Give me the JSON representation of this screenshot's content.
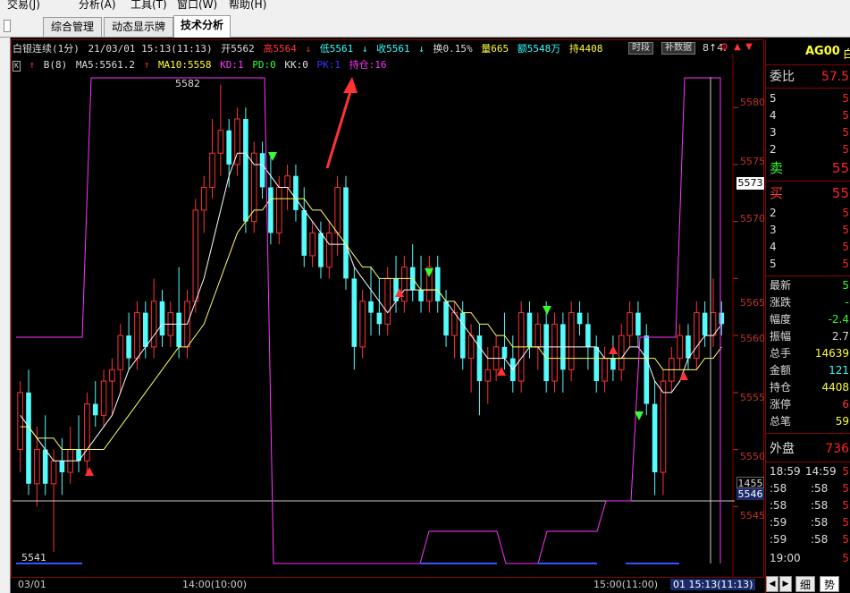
{
  "menu": {
    "items": [
      "交易(J)",
      "分析(A)",
      "工具(T)",
      "窗口(W)",
      "帮助(H)"
    ]
  },
  "tabs": [
    {
      "label": "综合管理",
      "active": false
    },
    {
      "label": "动态显示牌",
      "active": false
    },
    {
      "label": "技术分析",
      "active": true
    }
  ],
  "info_line1": {
    "title": "白银连续(1分)",
    "datetime": "21/03/01 15:13(11:13)",
    "open": "开5562",
    "high": "高5564",
    "low": "低5561",
    "close": "收5561",
    "turnover_rate": "换0.15%",
    "volume": "量665",
    "amount": "额5548万",
    "position": "持4408",
    "btn_timemode": "时段",
    "btn_supplement": "补数据",
    "tail": "8↑4."
  },
  "info_line2": {
    "k_button": "K",
    "indicator": "B(8)",
    "ma5": "MA5:5561.2",
    "ma10": "MA10:5558",
    "kd": "KD:1",
    "pd": "PD:0",
    "kk": "KK:0",
    "pk": "PK:1",
    "chicang": "持仓:16"
  },
  "right_panel": {
    "code": "AG00",
    "name": "白",
    "weibi_label": "委比",
    "weibi_value": "57.5",
    "asks": [
      {
        "level": "5",
        "price": "5"
      },
      {
        "level": "4",
        "price": "5"
      },
      {
        "level": "3",
        "price": "5"
      },
      {
        "level": "2",
        "price": "5"
      }
    ],
    "sell_label": "卖",
    "sell_value": "55",
    "buy_label": "买",
    "buy_value": "55",
    "bids": [
      {
        "level": "2",
        "price": "5"
      },
      {
        "level": "3",
        "price": "5"
      },
      {
        "level": "4",
        "price": "5"
      },
      {
        "level": "5",
        "price": "5"
      }
    ],
    "stats": [
      {
        "label": "最新",
        "value": "5"
      },
      {
        "label": "涨跌",
        "value": "-"
      },
      {
        "label": "幅度",
        "value": "-2.4"
      },
      {
        "label": "振幅",
        "value": "2.7"
      },
      {
        "label": "总手",
        "value": "14639"
      },
      {
        "label": "金额",
        "value": "121"
      },
      {
        "label": "持仓",
        "value": "4408"
      },
      {
        "label": "涨停",
        "value": "6"
      },
      {
        "label": "总笔",
        "value": "59"
      }
    ],
    "waipan_label": "外盘",
    "waipan_value": "736",
    "ticks": [
      {
        "time": "18:59",
        "time2": "14:59",
        "v": "5"
      },
      {
        "time": ":58",
        "time2": ":58",
        "v": "5"
      },
      {
        "time": ":58",
        "time2": ":58",
        "v": "5"
      },
      {
        "time": ":59",
        "time2": ":58",
        "v": "5"
      },
      {
        "time": ":59",
        "time2": ":58",
        "v": "5"
      },
      {
        "time": "19:00",
        "time2": "",
        "v": "5"
      }
    ],
    "tab_detail": "细",
    "tab_trend": "势"
  },
  "bottom_axis": {
    "left_date": "03/01",
    "mid_time": "14:00(10:00)",
    "right_time": "15:00(11:00)",
    "cursor_time": "01 15:13(11:13)"
  },
  "price_axis": {
    "ticks": [
      "5580",
      "5575",
      "5570",
      "5565",
      "5560",
      "5555",
      "5550",
      "5545"
    ],
    "current_label": "5573",
    "cursor_label_top": "1455",
    "cursor_label_bottom": "5546"
  },
  "chart_annotations": {
    "high_label": "5582",
    "low_label": "5541"
  },
  "chart_data": {
    "type": "candlestick",
    "title": "白银连续(1分)",
    "ylim": [
      5540,
      5583
    ],
    "y_ticks": [
      5545,
      5550,
      5555,
      5560,
      5565,
      5570,
      5575,
      5580
    ],
    "x_labels": [
      "03/01",
      "14:00(10:00)",
      "15:00(11:00)"
    ],
    "candles": [
      {
        "o": 5550,
        "h": 5556,
        "l": 5548,
        "c": 5555
      },
      {
        "o": 5555,
        "h": 5557,
        "l": 5546,
        "c": 5547
      },
      {
        "o": 5547,
        "h": 5552,
        "l": 5545,
        "c": 5550
      },
      {
        "o": 5550,
        "h": 5553,
        "l": 5546,
        "c": 5547
      },
      {
        "o": 5547,
        "h": 5550,
        "l": 5541,
        "c": 5549
      },
      {
        "o": 5549,
        "h": 5551,
        "l": 5546,
        "c": 5548
      },
      {
        "o": 5548,
        "h": 5552,
        "l": 5547,
        "c": 5550
      },
      {
        "o": 5550,
        "h": 5553,
        "l": 5548,
        "c": 5549
      },
      {
        "o": 5549,
        "h": 5555,
        "l": 5548,
        "c": 5554
      },
      {
        "o": 5554,
        "h": 5556,
        "l": 5552,
        "c": 5553
      },
      {
        "o": 5553,
        "h": 5557,
        "l": 5552,
        "c": 5556
      },
      {
        "o": 5556,
        "h": 5558,
        "l": 5553,
        "c": 5557
      },
      {
        "o": 5557,
        "h": 5561,
        "l": 5555,
        "c": 5560
      },
      {
        "o": 5560,
        "h": 5562,
        "l": 5557,
        "c": 5558
      },
      {
        "o": 5558,
        "h": 5563,
        "l": 5557,
        "c": 5562
      },
      {
        "o": 5562,
        "h": 5563,
        "l": 5558,
        "c": 5559
      },
      {
        "o": 5559,
        "h": 5565,
        "l": 5558,
        "c": 5563
      },
      {
        "o": 5563,
        "h": 5564,
        "l": 5559,
        "c": 5560
      },
      {
        "o": 5560,
        "h": 5563,
        "l": 5559,
        "c": 5562
      },
      {
        "o": 5562,
        "h": 5566,
        "l": 5558,
        "c": 5559
      },
      {
        "o": 5559,
        "h": 5564,
        "l": 5558,
        "c": 5563
      },
      {
        "o": 5563,
        "h": 5572,
        "l": 5562,
        "c": 5571
      },
      {
        "o": 5571,
        "h": 5574,
        "l": 5569,
        "c": 5573
      },
      {
        "o": 5573,
        "h": 5579,
        "l": 5572,
        "c": 5576
      },
      {
        "o": 5576,
        "h": 5582,
        "l": 5574,
        "c": 5578
      },
      {
        "o": 5578,
        "h": 5579,
        "l": 5573,
        "c": 5575
      },
      {
        "o": 5575,
        "h": 5580,
        "l": 5574,
        "c": 5579
      },
      {
        "o": 5579,
        "h": 5580,
        "l": 5569,
        "c": 5570
      },
      {
        "o": 5570,
        "h": 5577,
        "l": 5569,
        "c": 5576
      },
      {
        "o": 5576,
        "h": 5577,
        "l": 5572,
        "c": 5573
      },
      {
        "o": 5573,
        "h": 5576,
        "l": 5568,
        "c": 5569
      },
      {
        "o": 5569,
        "h": 5574,
        "l": 5568,
        "c": 5573
      },
      {
        "o": 5573,
        "h": 5575,
        "l": 5571,
        "c": 5574
      },
      {
        "o": 5574,
        "h": 5575,
        "l": 5570,
        "c": 5571
      },
      {
        "o": 5571,
        "h": 5573,
        "l": 5566,
        "c": 5567
      },
      {
        "o": 5567,
        "h": 5570,
        "l": 5566,
        "c": 5569
      },
      {
        "o": 5569,
        "h": 5570,
        "l": 5565,
        "c": 5566
      },
      {
        "o": 5566,
        "h": 5570,
        "l": 5565,
        "c": 5569
      },
      {
        "o": 5569,
        "h": 5574,
        "l": 5567,
        "c": 5573
      },
      {
        "o": 5573,
        "h": 5574,
        "l": 5564,
        "c": 5565
      },
      {
        "o": 5565,
        "h": 5566,
        "l": 5557,
        "c": 5559
      },
      {
        "o": 5559,
        "h": 5564,
        "l": 5558,
        "c": 5563
      },
      {
        "o": 5563,
        "h": 5566,
        "l": 5560,
        "c": 5562
      },
      {
        "o": 5562,
        "h": 5565,
        "l": 5560,
        "c": 5561
      },
      {
        "o": 5561,
        "h": 5566,
        "l": 5560,
        "c": 5565
      },
      {
        "o": 5565,
        "h": 5567,
        "l": 5562,
        "c": 5563
      },
      {
        "o": 5563,
        "h": 5567,
        "l": 5562,
        "c": 5566
      },
      {
        "o": 5566,
        "h": 5568,
        "l": 5563,
        "c": 5564
      },
      {
        "o": 5564,
        "h": 5567,
        "l": 5562,
        "c": 5563
      },
      {
        "o": 5563,
        "h": 5567,
        "l": 5562,
        "c": 5566
      },
      {
        "o": 5566,
        "h": 5567,
        "l": 5562,
        "c": 5563
      },
      {
        "o": 5563,
        "h": 5564,
        "l": 5559,
        "c": 5560
      },
      {
        "o": 5560,
        "h": 5563,
        "l": 5558,
        "c": 5562
      },
      {
        "o": 5562,
        "h": 5563,
        "l": 5557,
        "c": 5558
      },
      {
        "o": 5558,
        "h": 5561,
        "l": 5555,
        "c": 5560
      },
      {
        "o": 5560,
        "h": 5561,
        "l": 5553,
        "c": 5556
      },
      {
        "o": 5556,
        "h": 5559,
        "l": 5554,
        "c": 5557
      },
      {
        "o": 5557,
        "h": 5560,
        "l": 5556,
        "c": 5559
      },
      {
        "o": 5559,
        "h": 5562,
        "l": 5557,
        "c": 5558
      },
      {
        "o": 5558,
        "h": 5560,
        "l": 5555,
        "c": 5556
      },
      {
        "o": 5556,
        "h": 5563,
        "l": 5555,
        "c": 5562
      },
      {
        "o": 5562,
        "h": 5563,
        "l": 5558,
        "c": 5559
      },
      {
        "o": 5559,
        "h": 5562,
        "l": 5557,
        "c": 5561
      },
      {
        "o": 5561,
        "h": 5563,
        "l": 5555,
        "c": 5556
      },
      {
        "o": 5556,
        "h": 5562,
        "l": 5555,
        "c": 5561
      },
      {
        "o": 5561,
        "h": 5562,
        "l": 5555,
        "c": 5557
      },
      {
        "o": 5557,
        "h": 5563,
        "l": 5556,
        "c": 5562
      },
      {
        "o": 5562,
        "h": 5563,
        "l": 5560,
        "c": 5561
      },
      {
        "o": 5561,
        "h": 5562,
        "l": 5557,
        "c": 5559
      },
      {
        "o": 5559,
        "h": 5560,
        "l": 5555,
        "c": 5556
      },
      {
        "o": 5556,
        "h": 5559,
        "l": 5555,
        "c": 5558
      },
      {
        "o": 5558,
        "h": 5560,
        "l": 5556,
        "c": 5557
      },
      {
        "o": 5557,
        "h": 5561,
        "l": 5556,
        "c": 5560
      },
      {
        "o": 5560,
        "h": 5563,
        "l": 5559,
        "c": 5562
      },
      {
        "o": 5562,
        "h": 5563,
        "l": 5559,
        "c": 5560
      },
      {
        "o": 5560,
        "h": 5561,
        "l": 5553,
        "c": 5554
      },
      {
        "o": 5554,
        "h": 5556,
        "l": 5546,
        "c": 5548
      },
      {
        "o": 5548,
        "h": 5557,
        "l": 5546,
        "c": 5556
      },
      {
        "o": 5556,
        "h": 5559,
        "l": 5555,
        "c": 5558
      },
      {
        "o": 5558,
        "h": 5561,
        "l": 5557,
        "c": 5560
      },
      {
        "o": 5560,
        "h": 5561,
        "l": 5557,
        "c": 5558
      },
      {
        "o": 5558,
        "h": 5563,
        "l": 5557,
        "c": 5562
      },
      {
        "o": 5562,
        "h": 5563,
        "l": 5559,
        "c": 5560
      },
      {
        "o": 5560,
        "h": 5565,
        "l": 5559,
        "c": 5562
      },
      {
        "o": 5562,
        "h": 5563,
        "l": 5560,
        "c": 5561
      }
    ],
    "series": [
      {
        "name": "MA5",
        "color": "#ffffff",
        "values": [
          5553,
          5552,
          5551,
          5550,
          5549,
          5549,
          5549,
          5549,
          5550,
          5551,
          5552,
          5553,
          5555,
          5557,
          5558,
          5559,
          5560,
          5561,
          5561,
          5561,
          5561,
          5563,
          5565,
          5568,
          5571,
          5574,
          5576,
          5576,
          5575,
          5575,
          5574,
          5573,
          5573,
          5572,
          5571,
          5570,
          5569,
          5568,
          5568,
          5568,
          5566,
          5565,
          5564,
          5563,
          5562,
          5563,
          5564,
          5564,
          5564,
          5564,
          5564,
          5563,
          5562,
          5561,
          5560,
          5559,
          5558,
          5558,
          5558,
          5557,
          5558,
          5559,
          5559,
          5559,
          5559,
          5559,
          5559,
          5559,
          5559,
          5559,
          5558,
          5558,
          5558,
          5559,
          5559,
          5558,
          5556,
          5555,
          5555,
          5556,
          5558,
          5559,
          5560,
          5560,
          5561
        ]
      },
      {
        "name": "MA10",
        "color": "#ffff66",
        "values": [
          5552,
          5552,
          5551,
          5551,
          5551,
          5550,
          5550,
          5550,
          5550,
          5550,
          5550,
          5551,
          5552,
          5553,
          5554,
          5555,
          5556,
          5557,
          5558,
          5559,
          5559,
          5560,
          5561,
          5563,
          5565,
          5567,
          5569,
          5570,
          5571,
          5571,
          5572,
          5572,
          5572,
          5572,
          5572,
          5571,
          5571,
          5570,
          5569,
          5568,
          5567,
          5566,
          5566,
          5565,
          5565,
          5565,
          5565,
          5565,
          5564,
          5564,
          5564,
          5563,
          5563,
          5562,
          5562,
          5561,
          5561,
          5560,
          5560,
          5559,
          5559,
          5559,
          5559,
          5558,
          5558,
          5558,
          5558,
          5558,
          5558,
          5558,
          5558,
          5558,
          5558,
          5558,
          5558,
          5558,
          5558,
          5557,
          5557,
          5557,
          5557,
          5557,
          5558,
          5558,
          5559
        ]
      }
    ]
  }
}
